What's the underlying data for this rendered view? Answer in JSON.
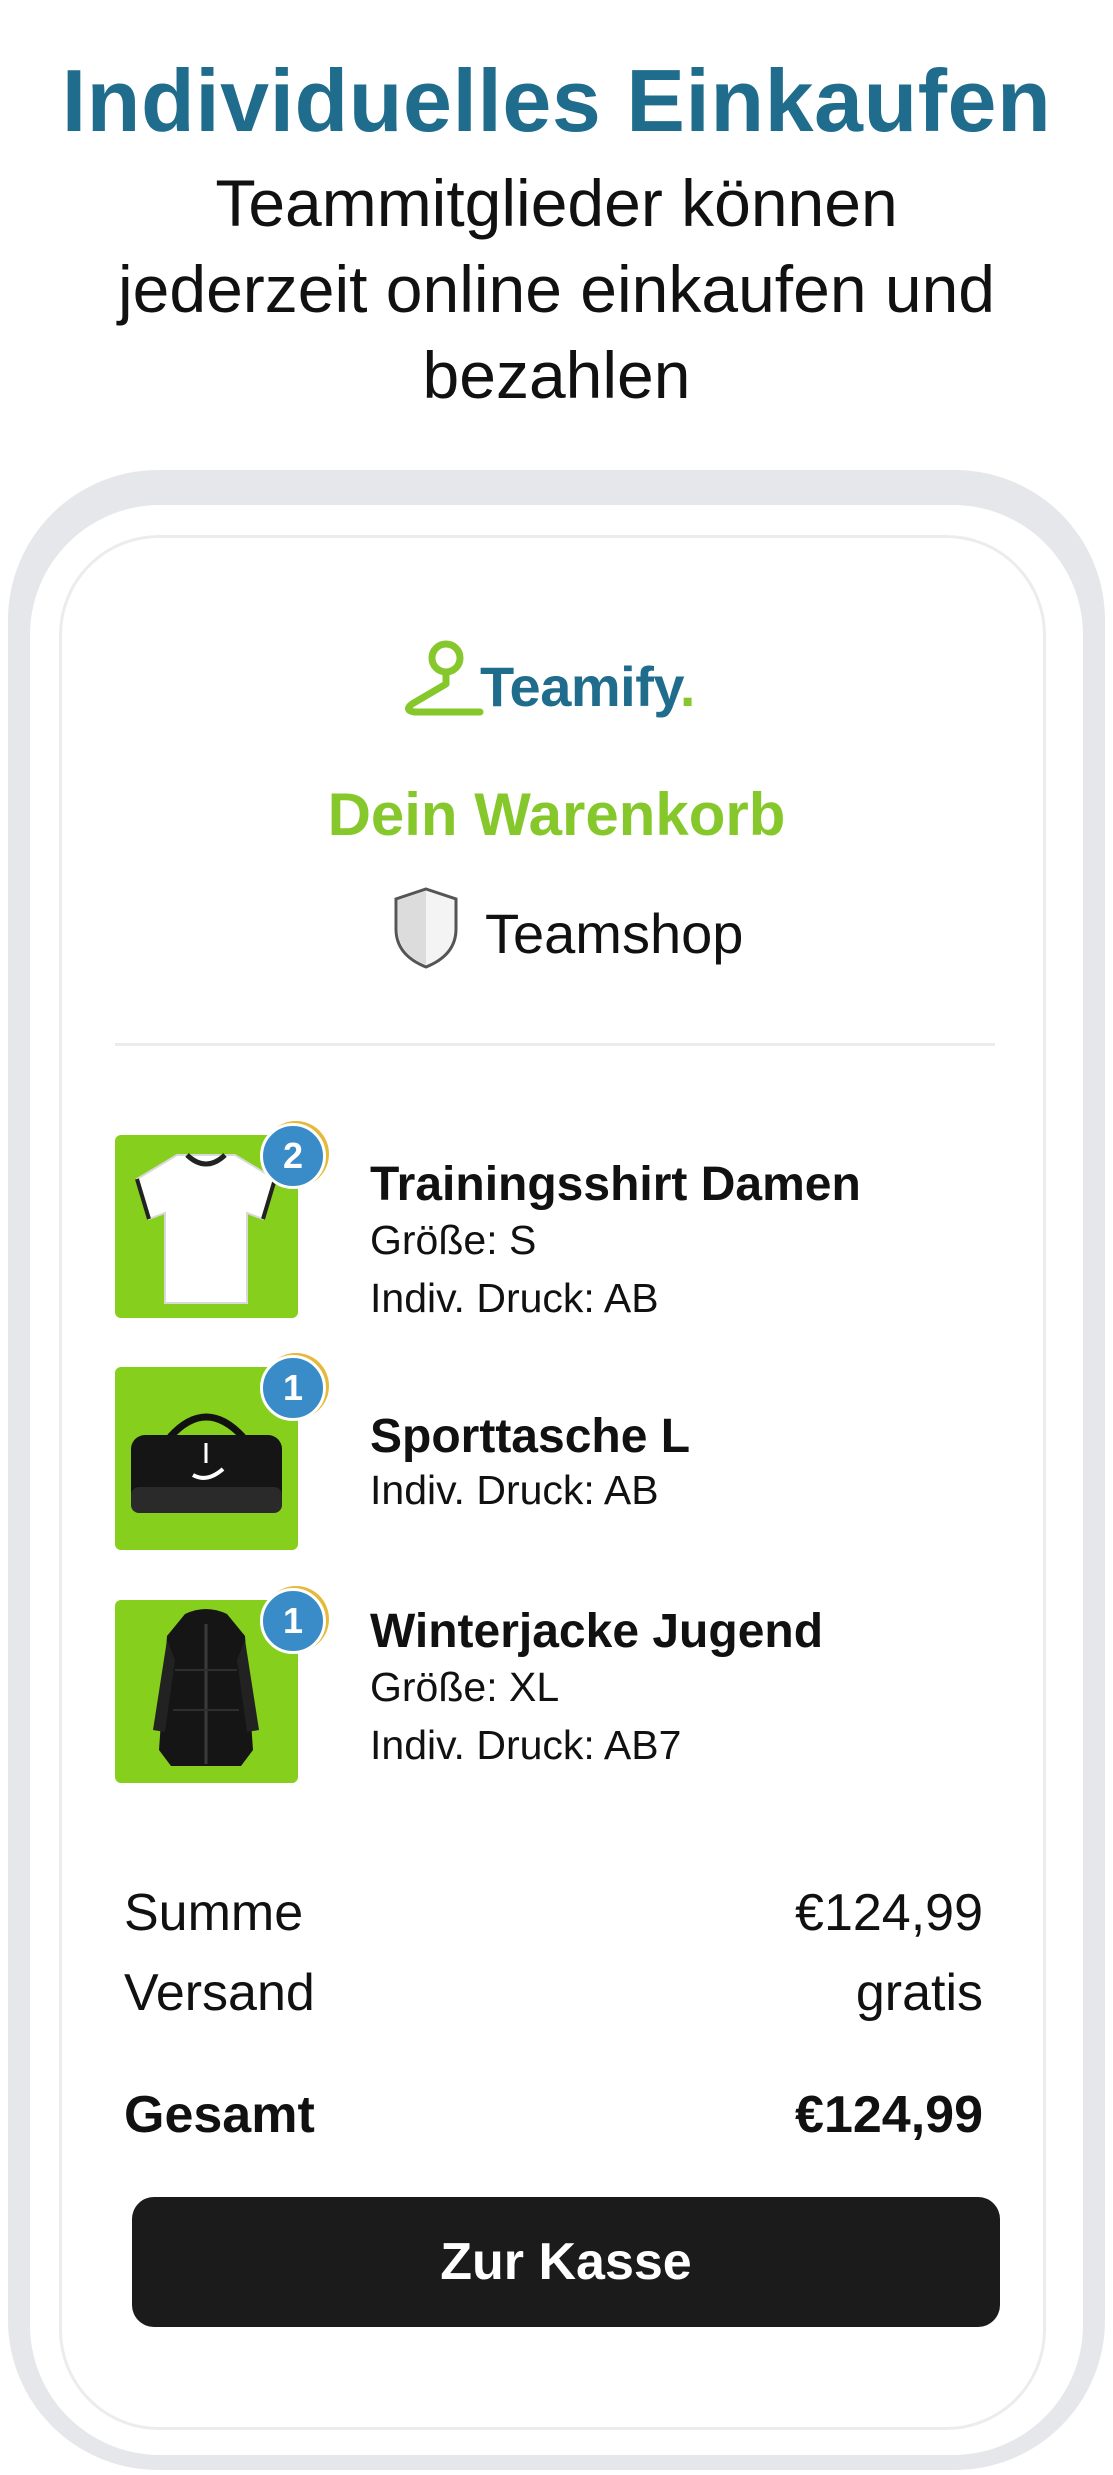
{
  "header": {
    "title": "Individuelles Einkaufen",
    "subtitle_lines": [
      "Teammitglieder können",
      "jederzeit online einkaufen und",
      "bezahlen"
    ]
  },
  "brand": {
    "name": "Teamify",
    "dot": ".",
    "primary_color": "#1f6c8c",
    "accent_color": "#86c82b"
  },
  "cart": {
    "title": "Dein Warenkorb",
    "shop_name": "Teamshop",
    "items": [
      {
        "quantity": "2",
        "title": "Trainingsshirt Damen",
        "lines": [
          "Größe: S",
          "Indiv. Druck: AB"
        ],
        "icon": "white-shirt-icon"
      },
      {
        "quantity": "1",
        "title": "Sporttasche L",
        "lines": [
          "Indiv. Druck: AB"
        ],
        "icon": "sports-bag-icon"
      },
      {
        "quantity": "1",
        "title": "Winterjacke Jugend",
        "lines": [
          "Größe: XL",
          "Indiv. Druck: AB7"
        ],
        "icon": "winter-jacket-icon"
      }
    ]
  },
  "summary": {
    "subtotal_label": "Summe",
    "subtotal_value": "€124,99",
    "shipping_label": "Versand",
    "shipping_value": "gratis",
    "total_label": "Gesamt",
    "total_value": "€124,99"
  },
  "actions": {
    "checkout_label": "Zur Kasse"
  }
}
